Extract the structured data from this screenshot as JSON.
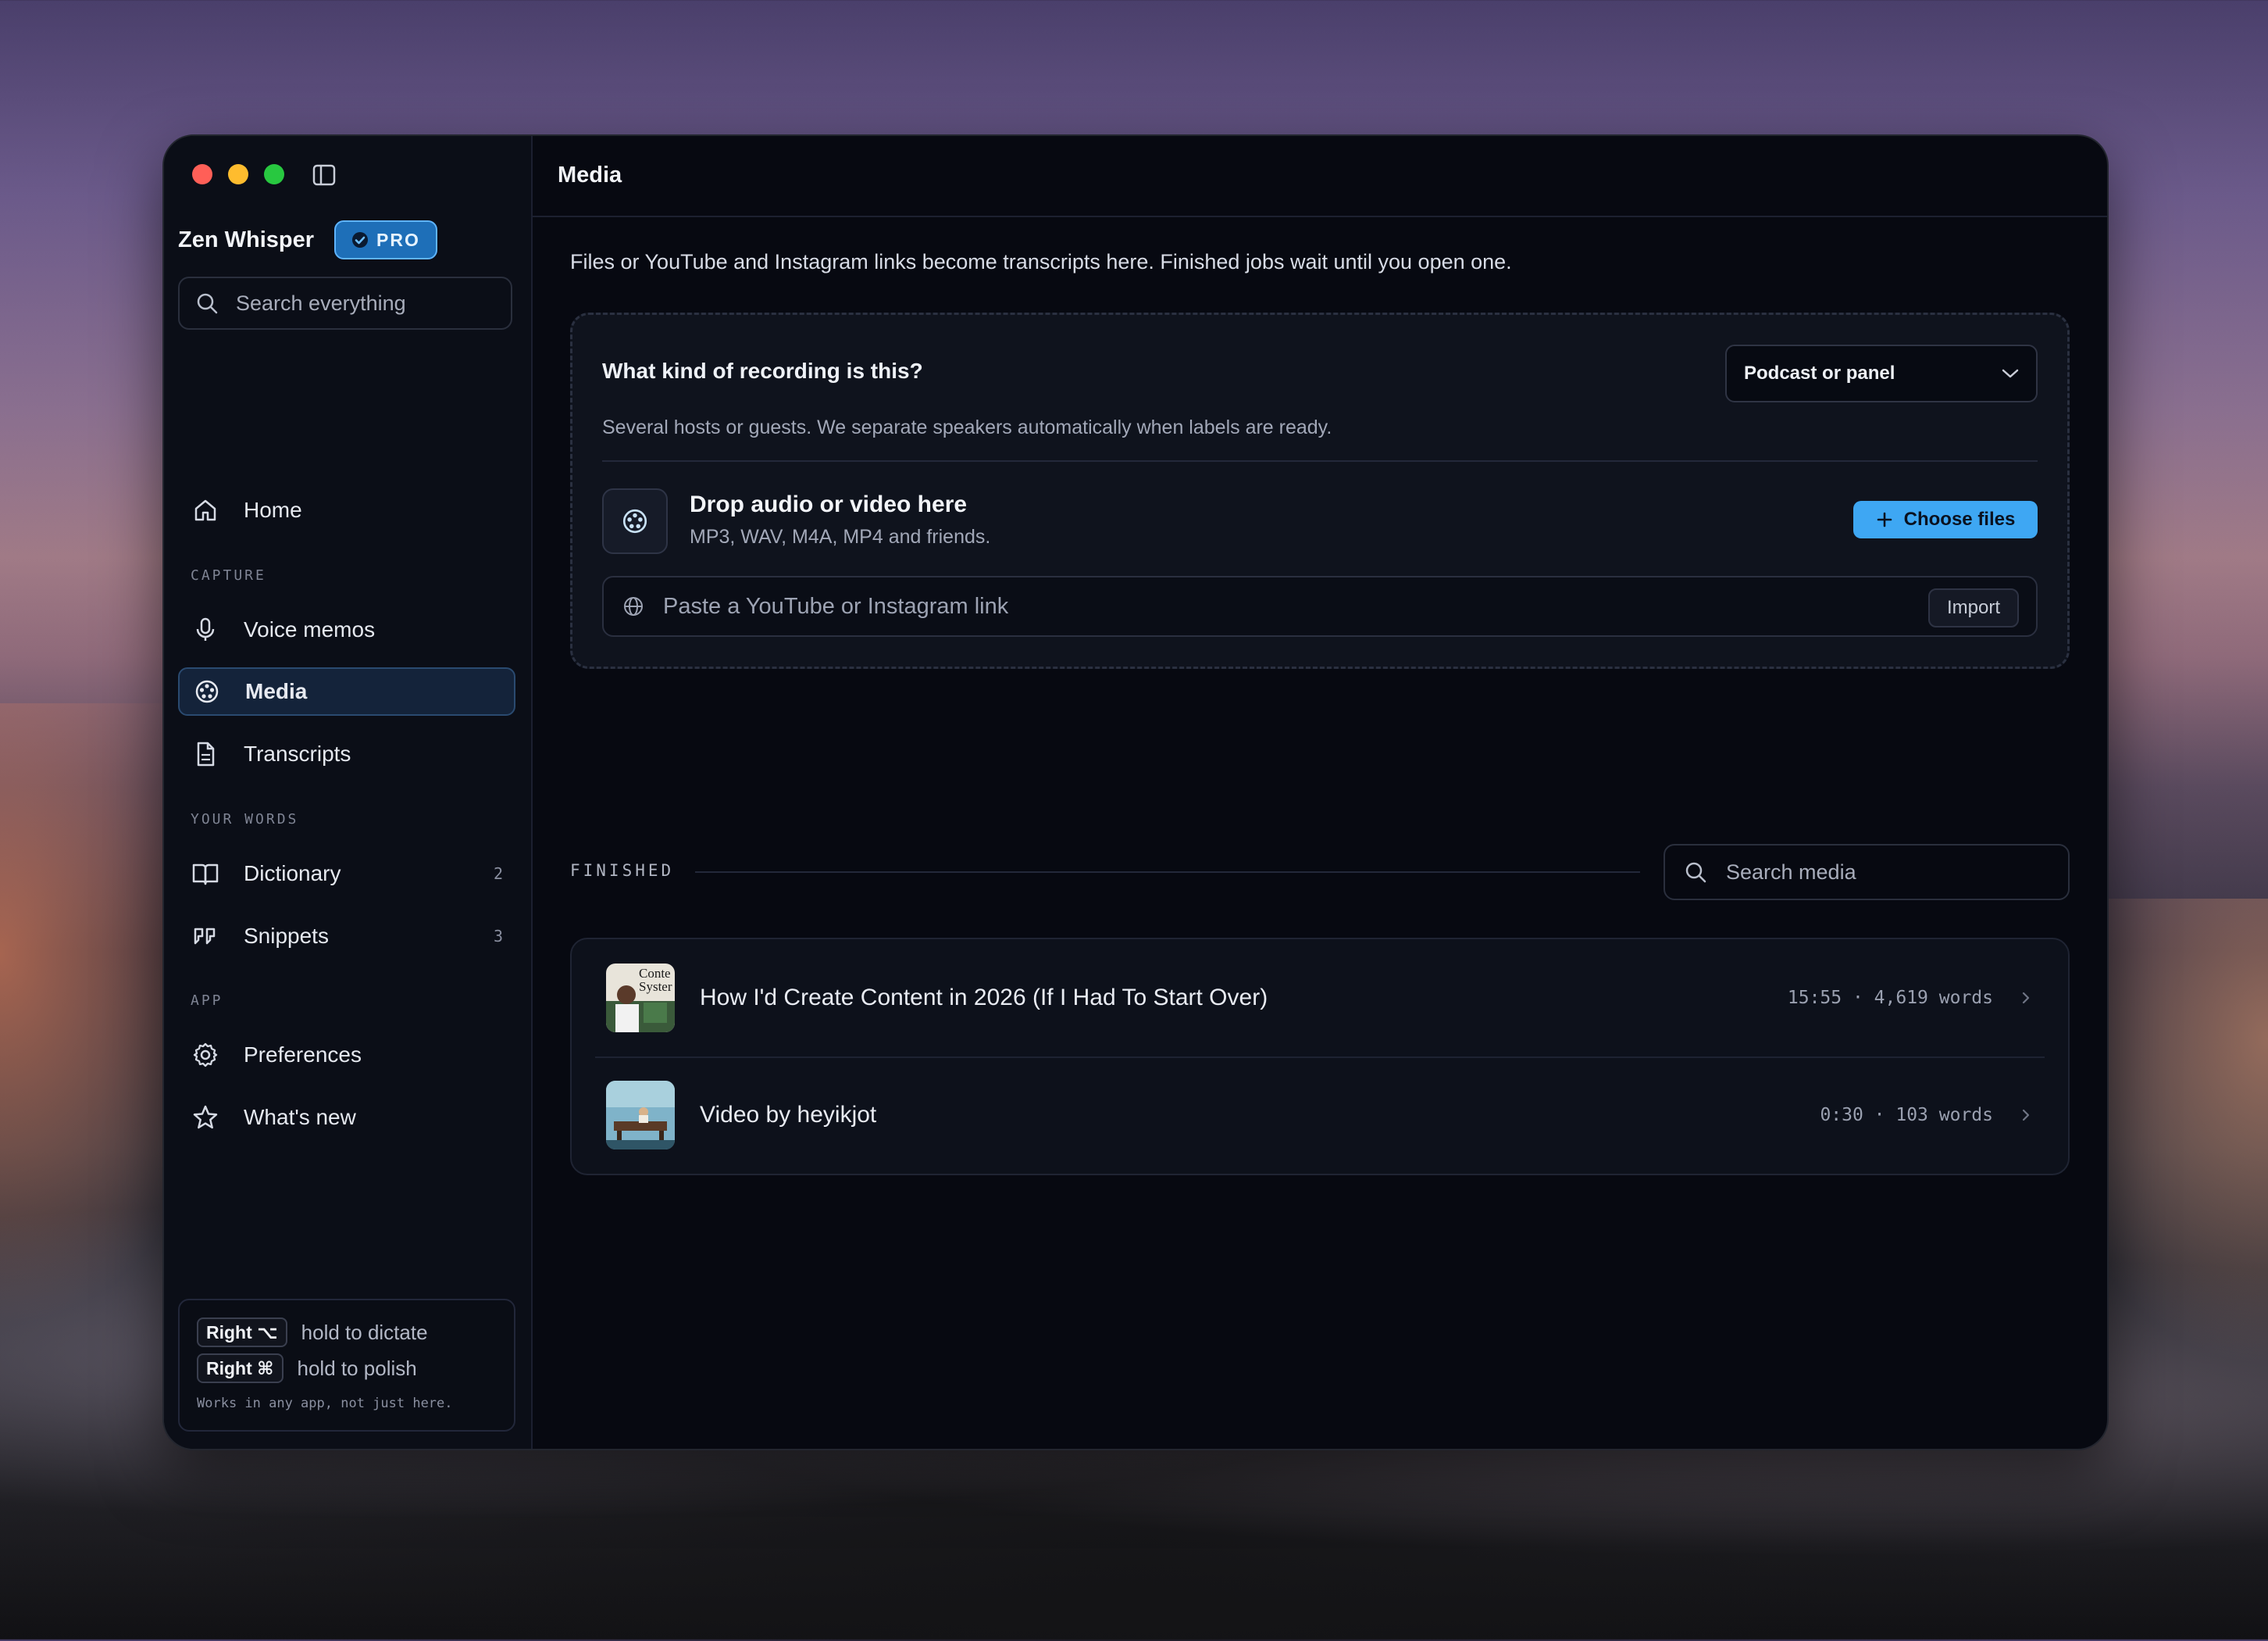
{
  "app": {
    "name": "Zen Whisper",
    "badge": "PRO"
  },
  "sidebar": {
    "search_placeholder": "Search everything",
    "home_label": "Home",
    "sections": {
      "capture": "CAPTURE",
      "your_words": "YOUR WORDS",
      "app": "APP"
    },
    "items": {
      "voice_memos": "Voice memos",
      "media": "Media",
      "transcripts": "Transcripts",
      "dictionary": "Dictionary",
      "dictionary_count": "2",
      "snippets": "Snippets",
      "snippets_count": "3",
      "preferences": "Preferences",
      "whats_new": "What's new"
    },
    "hints": {
      "dictate_key": "Right ⌥",
      "dictate_text": "hold to dictate",
      "polish_key": "Right ⌘",
      "polish_text": "hold to polish",
      "footer": "Works in any app, not just here."
    }
  },
  "main": {
    "title": "Media",
    "intro": "Files or YouTube and Instagram links become transcripts here. Finished jobs wait until you open one.",
    "upload": {
      "question": "What kind of recording is this?",
      "selected_type": "Podcast or panel",
      "description": "Several hosts or guests. We separate speakers automatically when labels are ready.",
      "drop_title": "Drop audio or video here",
      "drop_subtitle": "MP3, WAV, M4A, MP4 and friends.",
      "choose_button": "Choose files",
      "link_placeholder": "Paste a YouTube or Instagram link",
      "import_button": "Import"
    },
    "finished": {
      "label": "FINISHED",
      "search_placeholder": "Search media",
      "items": [
        {
          "title": "How I'd Create Content in 2026 (If I Had To Start Over)",
          "meta": "15:55 · 4,619 words",
          "thumb_text": "Conte Syster"
        },
        {
          "title": "Video by heyikjot",
          "meta": "0:30 · 103 words"
        }
      ]
    }
  },
  "colors": {
    "accent": "#3ea7f3",
    "window_bg": "#070911",
    "sidebar_bg": "#0b0e17"
  }
}
